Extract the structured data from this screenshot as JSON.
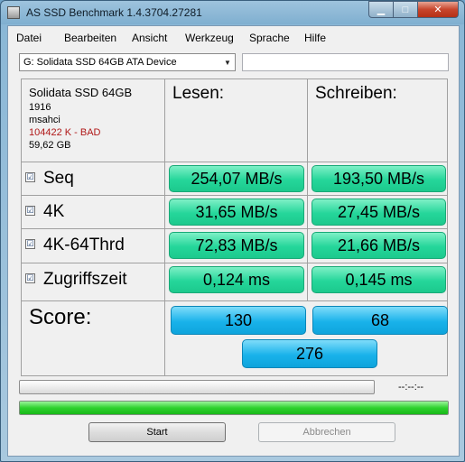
{
  "window": {
    "title": "AS SSD Benchmark 1.4.3704.27281",
    "min_label": "▁",
    "max_label": "□",
    "close_label": "✕"
  },
  "menu": {
    "items": [
      "Datei",
      "Bearbeiten",
      "Ansicht",
      "Werkzeug",
      "Sprache",
      "Hilfe"
    ]
  },
  "device_select": {
    "value": "G: Solidata SSD 64GB ATA Device",
    "arrow": "▼"
  },
  "drive_info": {
    "name": "Solidata SSD 64GB",
    "firmware": "1916",
    "driver": "msahci",
    "alignment": "104422 K - BAD",
    "size": "59,62 GB"
  },
  "columns": {
    "read": "Lesen:",
    "write": "Schreiben:"
  },
  "tests": [
    {
      "label": "Seq",
      "checked": "☑",
      "read": "254,07 MB/s",
      "write": "193,50 MB/s"
    },
    {
      "label": "4K",
      "checked": "☑",
      "read": "31,65 MB/s",
      "write": "27,45 MB/s"
    },
    {
      "label": "4K-64Thrd",
      "checked": "☑",
      "read": "72,83 MB/s",
      "write": "21,66 MB/s"
    },
    {
      "label": "Zugriffszeit",
      "checked": "☑",
      "read": "0,124 ms",
      "write": "0,145 ms"
    }
  ],
  "score": {
    "label": "Score:",
    "read": "130",
    "write": "68",
    "total": "276"
  },
  "progress": {
    "time": "--:--:--",
    "bar1_fraction": 0.0,
    "bar2_fraction": 1.0
  },
  "buttons": {
    "start": "Start",
    "cancel": "Abbrechen"
  },
  "colors": {
    "result_green": "#25d69a",
    "score_blue": "#19b2ea",
    "bad_red": "#b01818"
  }
}
